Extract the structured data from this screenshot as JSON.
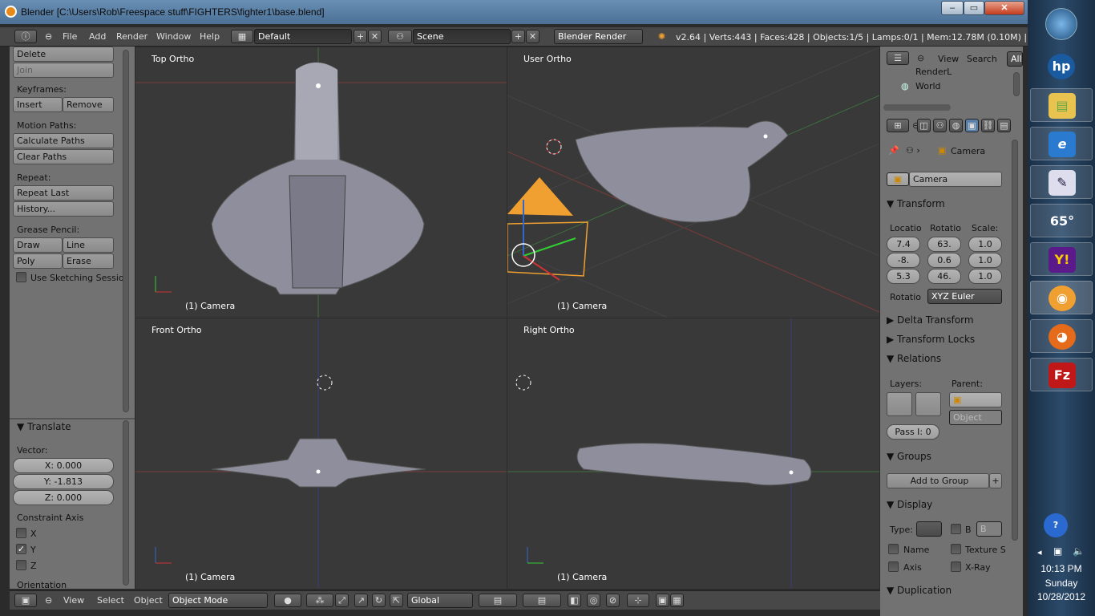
{
  "window": {
    "title": "Blender [C:\\Users\\Rob\\Freespace stuff\\FIGHTERS\\fighter1\\base.blend]"
  },
  "menu": {
    "items": [
      "File",
      "Add",
      "Render",
      "Window",
      "Help"
    ]
  },
  "header": {
    "layout": "Default",
    "scene": "Scene",
    "engine": "Blender Render",
    "info": "v2.64 | Verts:443 | Faces:428 | Objects:1/5 | Lamps:0/1 | Mem:12.78M (0.10M) | Cam"
  },
  "toolshelf": {
    "delete": "Delete",
    "join": "Join",
    "keyframes": "Keyframes:",
    "insert": "Insert",
    "remove": "Remove",
    "motion_paths": "Motion Paths:",
    "calculate_paths": "Calculate Paths",
    "clear_paths": "Clear Paths",
    "repeat": "Repeat:",
    "repeat_last": "Repeat Last",
    "history": "History...",
    "grease_pencil": "Grease Pencil:",
    "draw": "Draw",
    "line": "Line",
    "poly": "Poly",
    "erase": "Erase",
    "sketching": "Use Sketching Sessio"
  },
  "operator": {
    "title": "Translate",
    "vector": "Vector:",
    "x": "X: 0.000",
    "y": "Y: -1.813",
    "z": "Z: 0.000",
    "constraint": "Constraint Axis",
    "ax_x": "X",
    "ax_y": "Y",
    "ax_z": "Z",
    "orientation": "Orientation"
  },
  "viewports": {
    "top": "Top Ortho",
    "user": "User Ortho",
    "front": "Front Ortho",
    "right": "Right Ortho",
    "camera": "(1) Camera"
  },
  "outliner": {
    "view": "View",
    "search": "Search",
    "all": "All",
    "item1": "RenderL",
    "item2": "World"
  },
  "properties": {
    "crumb": "Camera",
    "object_name": "Camera",
    "transform": "Transform",
    "location": "Locatio",
    "rotation": "Rotatio",
    "scale": "Scale:",
    "loc": [
      "7.4",
      "-8.",
      "5.3"
    ],
    "rot": [
      "63.",
      "0.6",
      "46."
    ],
    "scl": [
      "1.0",
      "1.0",
      "1.0"
    ],
    "rot_mode_label": "Rotatio",
    "rot_mode": "XYZ Euler",
    "delta": "Delta Transform",
    "locks": "Transform Locks",
    "relations": "Relations",
    "layers": "Layers:",
    "parent": "Parent:",
    "parent_type": "Object",
    "pass": "Pass I: 0",
    "groups": "Groups",
    "add_group": "Add to Group",
    "display": "Display",
    "type": "Type:",
    "b": "B",
    "bopt": "B",
    "name": "Name",
    "texture": "Texture S",
    "axis": "Axis",
    "xray": "X-Ray",
    "duplication": "Duplication"
  },
  "bottom": {
    "view": "View",
    "select": "Select",
    "object": "Object",
    "mode": "Object Mode",
    "orient": "Global"
  },
  "taskbar": {
    "temp": "65°",
    "time": "10:13 PM",
    "day": "Sunday",
    "date": "10/28/2012"
  },
  "colors": {
    "accent": "#f0a030",
    "viewport": "#393939",
    "panel": "#727272"
  }
}
